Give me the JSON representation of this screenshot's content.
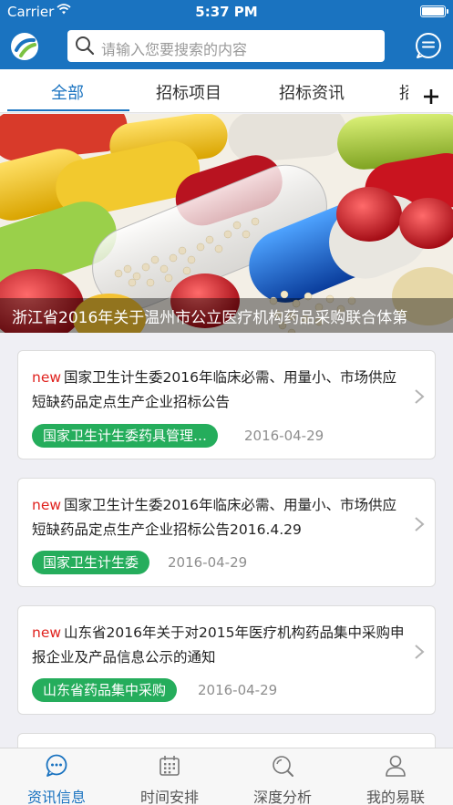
{
  "status_bar": {
    "carrier": "Carrier",
    "time": "5:37 PM"
  },
  "search": {
    "placeholder": "请输入您要搜索的内容"
  },
  "tabs": [
    {
      "label": "全部",
      "active": true
    },
    {
      "label": "招标项目",
      "active": false
    },
    {
      "label": "招标资讯",
      "active": false
    },
    {
      "label": "招",
      "active": false
    }
  ],
  "banner": {
    "caption": "浙江省2016年关于温州市公立医疗机构药品采购联合体第"
  },
  "news": [
    {
      "badge": "new",
      "title": "国家卫生计生委2016年临床必需、用量小、市场供应短缺药品定点生产企业招标公告",
      "source": "国家卫生计生委药具管理…",
      "date": "2016-04-29"
    },
    {
      "badge": "new",
      "title": "国家卫生计生委2016年临床必需、用量小、市场供应短缺药品定点生产企业招标公告2016.4.29",
      "source": "国家卫生计生委",
      "date": "2016-04-29"
    },
    {
      "badge": "new",
      "title": "山东省2016年关于对2015年医疗机构药品集中采购申报企业及产品信息公示的通知",
      "source": "山东省药品集中采购",
      "date": "2016-04-29"
    }
  ],
  "tab_bar": [
    {
      "label": "资讯信息",
      "icon": "chat-bubble-icon",
      "active": true
    },
    {
      "label": "时间安排",
      "icon": "calendar-icon",
      "active": false
    },
    {
      "label": "深度分析",
      "icon": "search-analysis-icon",
      "active": false
    },
    {
      "label": "我的易联",
      "icon": "user-icon",
      "active": false
    }
  ],
  "colors": {
    "primary": "#1a73c0",
    "tag_green": "#25ad5c",
    "new_red": "#e0231f"
  }
}
